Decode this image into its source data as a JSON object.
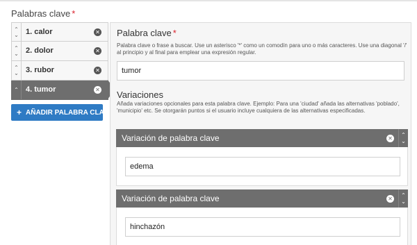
{
  "keywords": {
    "title": "Palabras clave",
    "required_mark": "*",
    "items": [
      {
        "label": "1. calor"
      },
      {
        "label": "2. dolor"
      },
      {
        "label": "3. rubor"
      },
      {
        "label": "4. tumor"
      }
    ],
    "add_button": "AÑADIR PALABRA CLA..."
  },
  "detail": {
    "title": "Palabra clave",
    "required_mark": "*",
    "help": "Palabra clave o frase a buscar. Use un asterisco '*' como un comodín para uno o más caracteres. Use una diagonal '/' al principio y al final para emplear una expresión regular.",
    "value": "tumor",
    "variations_title": "Variaciones",
    "variations_help": "Añada variaciones opcionales para esta palabra clave. Ejemplo: Para una 'ciudad' añada las alternativas 'poblado', 'municipio' etc. Se otorgarán puntos si el usuario incluye cualquiera de las alternativas especificadas.",
    "variations": [
      {
        "header": "Variación de palabra clave",
        "value": "edema"
      },
      {
        "header": "Variación de palabra clave",
        "value": "hinchazón"
      }
    ]
  },
  "icons": {
    "remove": "x-circle-icon",
    "sort": "chevron-up-down-icon",
    "add": "plus-icon"
  },
  "colors": {
    "accent": "#2f7bc4",
    "required": "#d9232d",
    "active": "#6e6e6e"
  }
}
